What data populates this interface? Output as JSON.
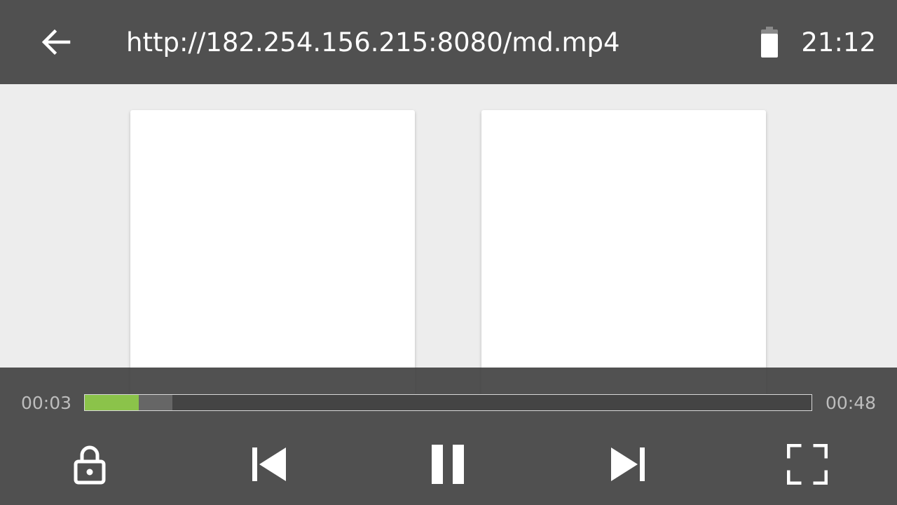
{
  "header": {
    "back_icon": "arrow-left-icon",
    "url": "http://182.254.156.215:8080/md.mp4",
    "battery_icon": "battery-icon",
    "clock": "21:12"
  },
  "player": {
    "elapsed": "00:03",
    "total": "00:48",
    "progress_fraction": 0.074,
    "buffered_fraction": 0.121,
    "progress_color": "#8bc34a",
    "controls": {
      "lock_icon": "lock-icon",
      "previous_icon": "skip-previous-icon",
      "pause_icon": "pause-icon",
      "next_icon": "skip-next-icon",
      "fullscreen_icon": "fullscreen-icon"
    }
  },
  "colors": {
    "bar_background": "#505050",
    "video_background": "#ededed",
    "text": "#ffffff",
    "time_text": "#bdbdbd"
  }
}
